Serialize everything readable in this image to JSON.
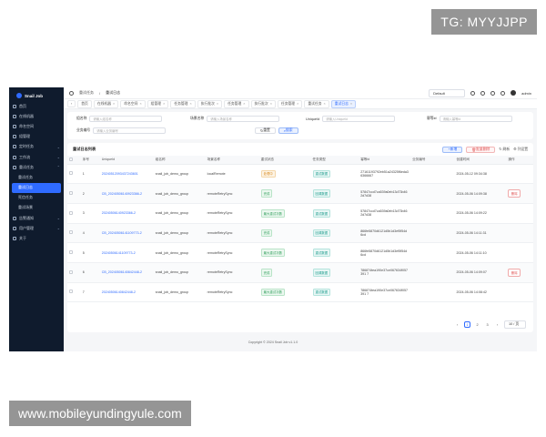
{
  "watermark_top": "TG: MYYJJPP",
  "watermark_bottom": "www.mobileyundingyule.com",
  "app": {
    "name": "Snail Job"
  },
  "sidebar": {
    "items": [
      {
        "label": "首页",
        "chevron": ""
      },
      {
        "label": "在线机器",
        "chevron": ""
      },
      {
        "label": "命名空间",
        "chevron": ""
      },
      {
        "label": "组管理",
        "chevron": ""
      },
      {
        "label": "定时任务",
        "chevron": "⌄"
      },
      {
        "label": "工作流",
        "chevron": "⌄"
      },
      {
        "label": "重试任务",
        "chevron": "⌃"
      },
      {
        "label": "重试任务",
        "chevron": "",
        "sub": true
      },
      {
        "label": "重试日志",
        "chevron": "",
        "sub": true,
        "active": true
      },
      {
        "label": "死信任务",
        "chevron": "",
        "sub": true
      },
      {
        "label": "重试场景",
        "chevron": "",
        "sub": true
      },
      {
        "label": "告警通知",
        "chevron": "⌄"
      },
      {
        "label": "用户管理",
        "chevron": "⌄"
      },
      {
        "label": "关于",
        "chevron": ""
      }
    ]
  },
  "topbar": {
    "crumbs": [
      "重试任务",
      "重试日志"
    ],
    "namespace_select": "Default",
    "user": "admin"
  },
  "tabs": [
    {
      "label": "首页",
      "active": false
    },
    {
      "label": "在线机器",
      "active": false
    },
    {
      "label": "命名空间",
      "active": false
    },
    {
      "label": "组管理",
      "active": false
    },
    {
      "label": "任务管理",
      "active": false
    },
    {
      "label": "执行批次",
      "active": false
    },
    {
      "label": "任务管理",
      "active": false
    },
    {
      "label": "执行批次",
      "active": false
    },
    {
      "label": "任务管理",
      "active": false
    },
    {
      "label": "重试任务",
      "active": false
    },
    {
      "label": "重试日志",
      "active": true
    }
  ],
  "filter": {
    "group_label": "组名称",
    "group_placeholder": "请输入组名称",
    "scene_label": "场景名称",
    "scene_placeholder": "请输入场景名称",
    "uid_label": "UniqueId",
    "uid_placeholder": "请输入UniqueId",
    "idem_label": "幂等id",
    "idem_placeholder": "请输入幂等id",
    "biz_label": "业务编号",
    "biz_placeholder": "请输入业务编号",
    "reset": "重置",
    "search": "搜索"
  },
  "table": {
    "title": "重试日志列表",
    "add": "新增",
    "batch_delete": "批量删除",
    "refresh": "刷新",
    "column_settings": "列设置",
    "headers": [
      "序号",
      "UniqueId",
      "组名称",
      "场景名称",
      "重试状态",
      "任务类型",
      "幂等id",
      "业务编号",
      "创建时间",
      "操作"
    ],
    "rows": [
      {
        "no": "1",
        "uid": "20240512093437243601",
        "group": "snail_job_demo_group",
        "scene": "localRemote",
        "status": "处理中",
        "status_color": "orange",
        "type": "重试数据",
        "idem": "27161193792eb51a24325f6eda36366667",
        "biz": "",
        "time": "2024-05-12 09:34:38",
        "op": ""
      },
      {
        "no": "2",
        "uid": "CB_20240506140923366-2",
        "group": "snail_job_demo_group",
        "scene": "remoteRetrySync",
        "status": "完成",
        "status_color": "green",
        "type": "回调数据",
        "idem": "57847ccd7ca539a0eb13d73b462d7d38",
        "biz": "",
        "time": "2024-05-06 14:09:38",
        "op": "删除"
      },
      {
        "no": "3",
        "uid": "20240506140923366-2",
        "group": "snail_job_demo_group",
        "scene": "remoteRetrySync",
        "status": "最大重试次数",
        "status_color": "green",
        "type": "重试数据",
        "idem": "57847ccd7ca539a0eb13d73b462d7d38",
        "biz": "",
        "time": "2024-05-06 14:09:22",
        "op": ""
      },
      {
        "no": "4",
        "uid": "CB_20240506141109773-2",
        "group": "snail_job_demo_group",
        "scene": "remoteRetrySync",
        "status": "完成",
        "status_color": "green",
        "type": "回调数据",
        "idem": "866fe5870d6121d5b1d3ef5f54d6cd",
        "biz": "",
        "time": "2024-05-06 14:11:31",
        "op": ""
      },
      {
        "no": "5",
        "uid": "20240506141109773-2",
        "group": "snail_job_demo_group",
        "scene": "remoteRetrySync",
        "status": "最大重试次数",
        "status_color": "green",
        "type": "重试数据",
        "idem": "866fe5870d6121d5b1d3ef5f54d6cd",
        "biz": "",
        "time": "2024-05-06 14:11:10",
        "op": ""
      },
      {
        "no": "6",
        "uid": "CB_20240506140842448-2",
        "group": "snail_job_demo_group",
        "scene": "remoteRetrySync",
        "status": "完成",
        "status_color": "green",
        "type": "回调数据",
        "idem": "786874tea190e37ce067634f057391 7",
        "biz": "",
        "time": "2024-05-06 14:09:07",
        "op": "删除"
      },
      {
        "no": "7",
        "uid": "20240506140842448-2",
        "group": "snail_job_demo_group",
        "scene": "remoteRetrySync",
        "status": "最大重试次数",
        "status_color": "green",
        "type": "重试数据",
        "idem": "786874tea190e37ce067634f057391 7",
        "biz": "",
        "time": "2024-05-06 14:08:42",
        "op": ""
      }
    ]
  },
  "pager": {
    "prev": "‹",
    "pages": [
      "1",
      "2",
      "3"
    ],
    "active": "1",
    "next": "›",
    "size": "10 / 页"
  },
  "footer": "Copyright © 2024 Snail Job v1.1.0"
}
